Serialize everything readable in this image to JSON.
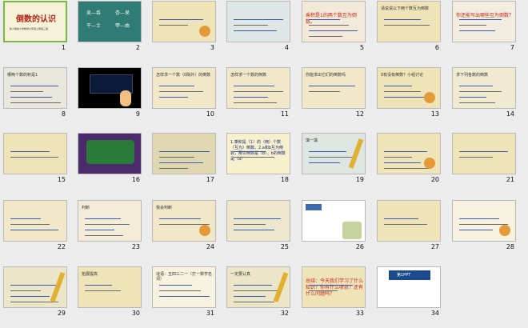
{
  "slides": [
    {
      "n": "1",
      "title": "倒数的认识",
      "sub": "新人教版小学数学六年级上册第三章"
    },
    {
      "n": "2",
      "pairs": [
        "吴—呑",
        "杏—呆",
        "干—士",
        "甲—由"
      ]
    },
    {
      "n": "3",
      "tag": "观察与发现"
    },
    {
      "n": "4",
      "tag": "我会算"
    },
    {
      "n": "5",
      "text": "乘积是1的两个数互为倒数。"
    },
    {
      "n": "6",
      "text": "请说说以下两个数互为倒数"
    },
    {
      "n": "7",
      "text": "你还能写出哪些互为倒数？"
    },
    {
      "n": "8",
      "text": "哪两个数的积是1"
    },
    {
      "n": "9",
      "text": ""
    },
    {
      "n": "10",
      "text": "怎样求一个数（0除外）的倒数"
    },
    {
      "n": "11",
      "text": "怎样求一个数的倒数"
    },
    {
      "n": "12",
      "text": "你能求出它们的倒数吗"
    },
    {
      "n": "13",
      "text": "0有没有倒数？小组讨论"
    },
    {
      "n": "14",
      "text": "求下列各数的倒数"
    },
    {
      "n": "15",
      "text": ""
    },
    {
      "n": "16",
      "text": ""
    },
    {
      "n": "17",
      "text": ""
    },
    {
      "n": "18",
      "text": "1.乘积是（1）的（两）个数（互为）倒数。2.a和b互为倒数，那么倒数是（b），b的倒数是（a）"
    },
    {
      "n": "19",
      "text": "填一填"
    },
    {
      "n": "20",
      "text": ""
    },
    {
      "n": "21",
      "text": ""
    },
    {
      "n": "22",
      "text": ""
    },
    {
      "n": "23",
      "text": "判断"
    },
    {
      "n": "24",
      "text": "我会判断"
    },
    {
      "n": "25",
      "text": ""
    },
    {
      "n": "26",
      "text": "看一看"
    },
    {
      "n": "27",
      "text": ""
    },
    {
      "n": "28",
      "text": ""
    },
    {
      "n": "29",
      "text": ""
    },
    {
      "n": "30",
      "text": "拓展提高"
    },
    {
      "n": "31",
      "text": "谜语：五四三二一（打一数学名词）"
    },
    {
      "n": "32",
      "text": "一定要认真"
    },
    {
      "n": "33",
      "text": "总结：今天我们学习了什么知识？你有什么收获？还有什么问题吗？"
    },
    {
      "n": "34",
      "text": "第1PPT"
    }
  ]
}
